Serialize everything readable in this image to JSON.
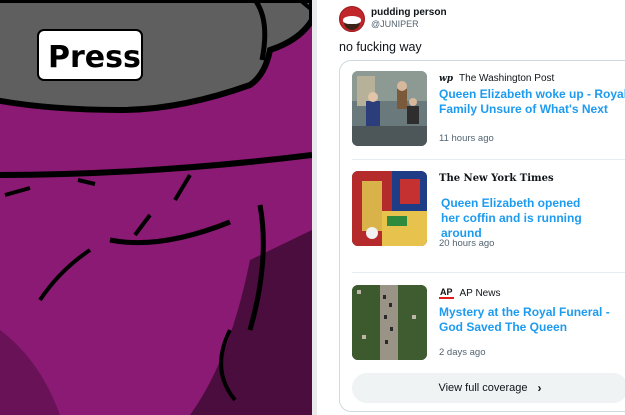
{
  "artwork": {
    "label": "Press",
    "colors": {
      "background": "#8a1a73",
      "shadow": "#4a0d3e",
      "cap": "#5f5f5f",
      "outline": "#000000"
    }
  },
  "tweet": {
    "user_name": "pudding person",
    "user_handle": "@JUNIPER",
    "text": "no fucking way",
    "avatar_icon": "pudding-avatar-icon"
  },
  "news_card": {
    "items": [
      {
        "source_icon": "washington-post-logo",
        "source_mark": "wp",
        "source": "The Washington Post",
        "headline": "Queen Elizabeth woke up - Royal Family Unsure of What's Next",
        "time": "11 hours ago"
      },
      {
        "source_icon": "new-york-times-logo",
        "source_mark": "The New York Times",
        "source": "",
        "headline": "Queen Elizabeth opened her coffin and is running around",
        "time": "20 hours ago"
      },
      {
        "source_icon": "ap-news-logo",
        "source_mark": "AP",
        "source": "AP News",
        "headline": "Mystery at the Royal Funeral - God Saved The Queen",
        "time": "2 days ago"
      }
    ],
    "view_full_coverage": "View full coverage",
    "coverage_icon": "chevron-right-icon"
  },
  "colors": {
    "link": "#1d9bf0",
    "muted": "#536471",
    "border": "#cfd9de",
    "button_bg": "#eff3f4"
  }
}
